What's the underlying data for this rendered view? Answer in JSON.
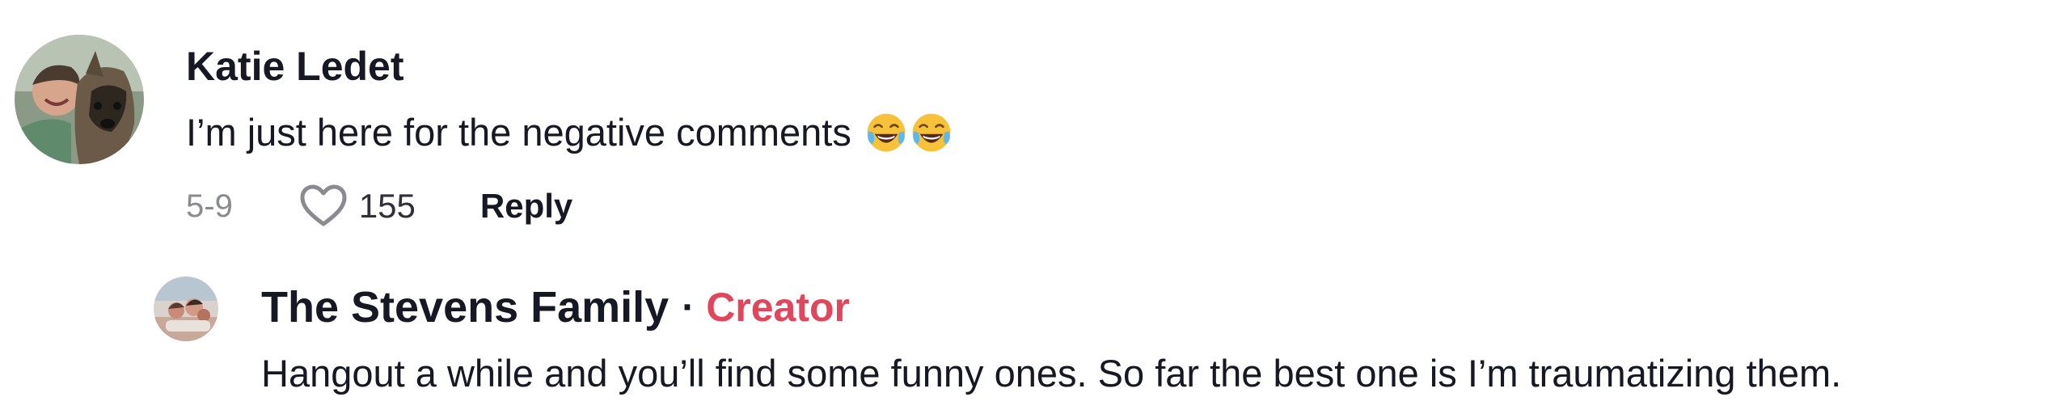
{
  "comment": {
    "author": "Katie Ledet",
    "text": "I’m just here for the negative comments",
    "emojis": [
      "face-with-tears-of-joy-icon",
      "face-with-tears-of-joy-icon"
    ],
    "date": "5-9",
    "likes": "155",
    "reply_label": "Reply"
  },
  "reply": {
    "author": "The Stevens Family",
    "separator": "·",
    "badge": "Creator",
    "text": "Hangout a while and you’ll find some funny ones. So far the best one is I’m traumatizing them."
  },
  "colors": {
    "text": "#161823",
    "muted": "#8a8b91",
    "creator_badge": "#e0475d"
  }
}
